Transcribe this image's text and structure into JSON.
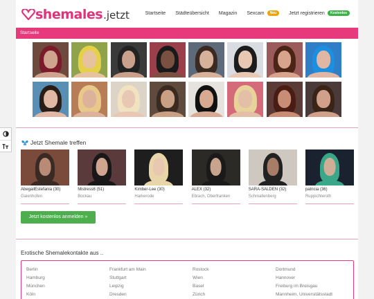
{
  "logo": {
    "brand": "shemales",
    "tld": ".jetzt"
  },
  "nav": [
    {
      "label": "Startseite"
    },
    {
      "label": "Städteübersicht"
    },
    {
      "label": "Magazin"
    },
    {
      "label": "Sexcam",
      "badge": "Neu"
    },
    {
      "label": "Jetzt registrieren",
      "badge": "Kostenlos"
    }
  ],
  "breadcrumb": "Startseite",
  "colors": {
    "accent": "#e73a7d",
    "cta": "#4cae4c",
    "badge_new": "#f0a400",
    "badge_free": "#3cb14a"
  },
  "gallery_rows": 2,
  "meet": {
    "title": "Jetzt Shemale treffen",
    "icon": "butterfly-icon",
    "profiles": [
      {
        "name": "AbegailEstefania (30)",
        "location": "Gaienhofen"
      },
      {
        "name": "Mistress6 (51)",
        "location": "Bockau"
      },
      {
        "name": "Kimber-Lee (30)",
        "location": "Harkerode"
      },
      {
        "name": "ALEX (32)",
        "location": "Ebrach, Oberfranken"
      },
      {
        "name": "SARA-SALDEN (32)",
        "location": "Schmallenberg"
      },
      {
        "name": "patricia (36)",
        "location": "Ruppichteroth"
      }
    ],
    "cta": "Jetzt kostenlos anmelden »"
  },
  "contacts": {
    "title": "Erotische Shemalekontakte aus ..",
    "columns": [
      [
        "Berlin",
        "Hamburg",
        "München",
        "Köln"
      ],
      [
        "Frankfurt am Main",
        "Stuttgart",
        "Leipzig",
        "Dresden"
      ],
      [
        "Rostock",
        "Wien",
        "Basel",
        "Zürich"
      ],
      [
        "Dortmund",
        "Hannover",
        "Freiburg im Breisgau",
        "Mannheim, Universitätsstadt"
      ]
    ]
  },
  "accessibility": [
    {
      "icon": "contrast-icon"
    },
    {
      "icon": "text-size-icon"
    }
  ]
}
